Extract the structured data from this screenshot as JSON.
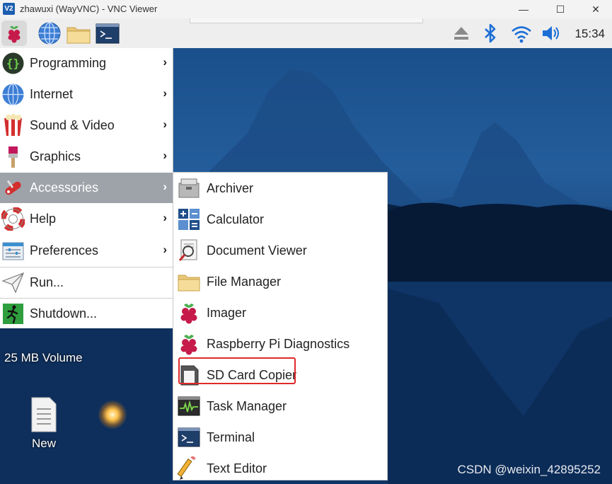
{
  "window": {
    "logo_text": "V2",
    "title": "zhawuxi (WayVNC) - VNC Viewer",
    "minimize_glyph": "—",
    "maximize_glyph": "☐",
    "close_glyph": "✕"
  },
  "taskbar": {
    "launcher_icons": [
      "raspberry-pi-menu-icon",
      "web-browser-icon",
      "file-manager-icon",
      "terminal-icon"
    ],
    "tray_icons": [
      "eject-icon",
      "bluetooth-icon",
      "wifi-icon",
      "volume-icon"
    ],
    "clock": "15:34"
  },
  "main_menu": {
    "items": [
      {
        "label": "Programming",
        "icon": "programming-icon",
        "has_submenu": true
      },
      {
        "label": "Internet",
        "icon": "internet-icon",
        "has_submenu": true
      },
      {
        "label": "Sound & Video",
        "icon": "sound-video-icon",
        "has_submenu": true
      },
      {
        "label": "Graphics",
        "icon": "graphics-icon",
        "has_submenu": true
      },
      {
        "label": "Accessories",
        "icon": "accessories-icon",
        "has_submenu": true,
        "selected": true
      },
      {
        "label": "Help",
        "icon": "help-icon",
        "has_submenu": true
      },
      {
        "label": "Preferences",
        "icon": "preferences-icon",
        "has_submenu": true
      },
      {
        "label": "Run...",
        "icon": "run-icon",
        "has_submenu": false
      },
      {
        "label": "Shutdown...",
        "icon": "shutdown-icon",
        "has_submenu": false
      }
    ],
    "arrow": "›"
  },
  "accessories_menu": {
    "items": [
      {
        "label": "Archiver",
        "icon": "archiver-icon"
      },
      {
        "label": "Calculator",
        "icon": "calculator-icon"
      },
      {
        "label": "Document Viewer",
        "icon": "document-viewer-icon"
      },
      {
        "label": "File Manager",
        "icon": "folder-icon"
      },
      {
        "label": "Imager",
        "icon": "raspberry-icon"
      },
      {
        "label": "Raspberry Pi Diagnostics",
        "icon": "raspberry-icon"
      },
      {
        "label": "SD Card Copier",
        "icon": "sd-card-icon",
        "highlighted": true
      },
      {
        "label": "Task Manager",
        "icon": "task-manager-icon"
      },
      {
        "label": "Terminal",
        "icon": "terminal-icon"
      },
      {
        "label": "Text Editor",
        "icon": "text-editor-icon"
      }
    ]
  },
  "desktop": {
    "drive_label": "25 MB Volume",
    "new_file_label": "New",
    "watermark": "CSDN @weixin_42895252"
  },
  "colors": {
    "selected_item": "#9ea3aa",
    "highlight_box": "#e02a2a",
    "accent_blue": "#1d6fd6"
  }
}
